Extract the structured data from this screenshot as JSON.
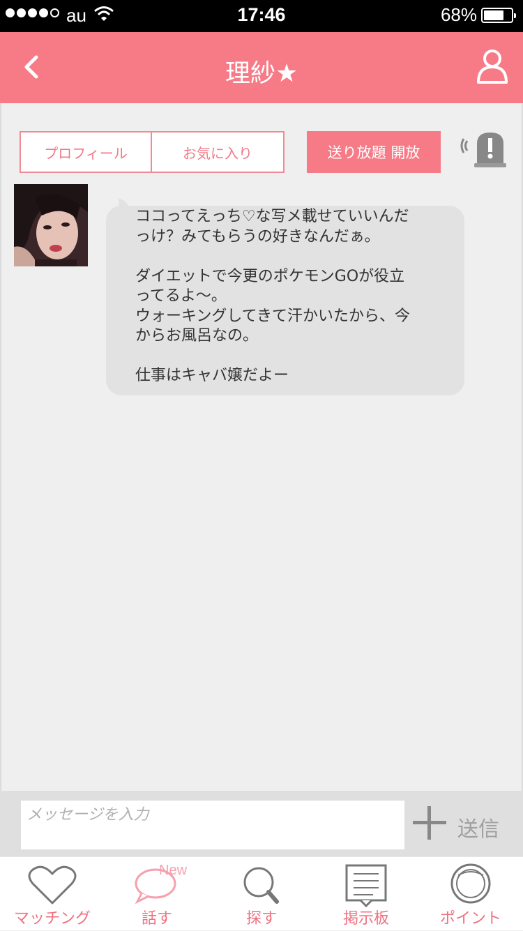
{
  "status_bar": {
    "carrier": "au",
    "time": "17:46",
    "battery": "68%",
    "battery_level": 0.68,
    "signal_bars": 4
  },
  "header": {
    "title": "理紗★",
    "color": "#f77a87"
  },
  "actions": {
    "profile_label": "プロフィール",
    "favorite_label": "お気に入り",
    "unlimited_label": "送り放題 開放"
  },
  "message": {
    "text": "ココってえっち♡な写メ載せていいんだ\nっけ？みてもらうの好きなんだぁ。\n\nダイエットで今更のポケモンGOが役立\nってるよ〜。\nウォーキングしてきて汗かいたから、今\nからお風呂なの。\n\n仕事はキャバ嬢だよー"
  },
  "input": {
    "placeholder": "メッセージを入力",
    "value": "",
    "send_label": "送信"
  },
  "tabbar": {
    "items": [
      {
        "label": "マッチング",
        "icon": "heart-icon"
      },
      {
        "label": "話す",
        "icon": "chat-icon",
        "badge": "New"
      },
      {
        "label": "探す",
        "icon": "search-icon"
      },
      {
        "label": "掲示板",
        "icon": "board-icon"
      },
      {
        "label": "ポイント",
        "icon": "coin-icon"
      }
    ]
  }
}
